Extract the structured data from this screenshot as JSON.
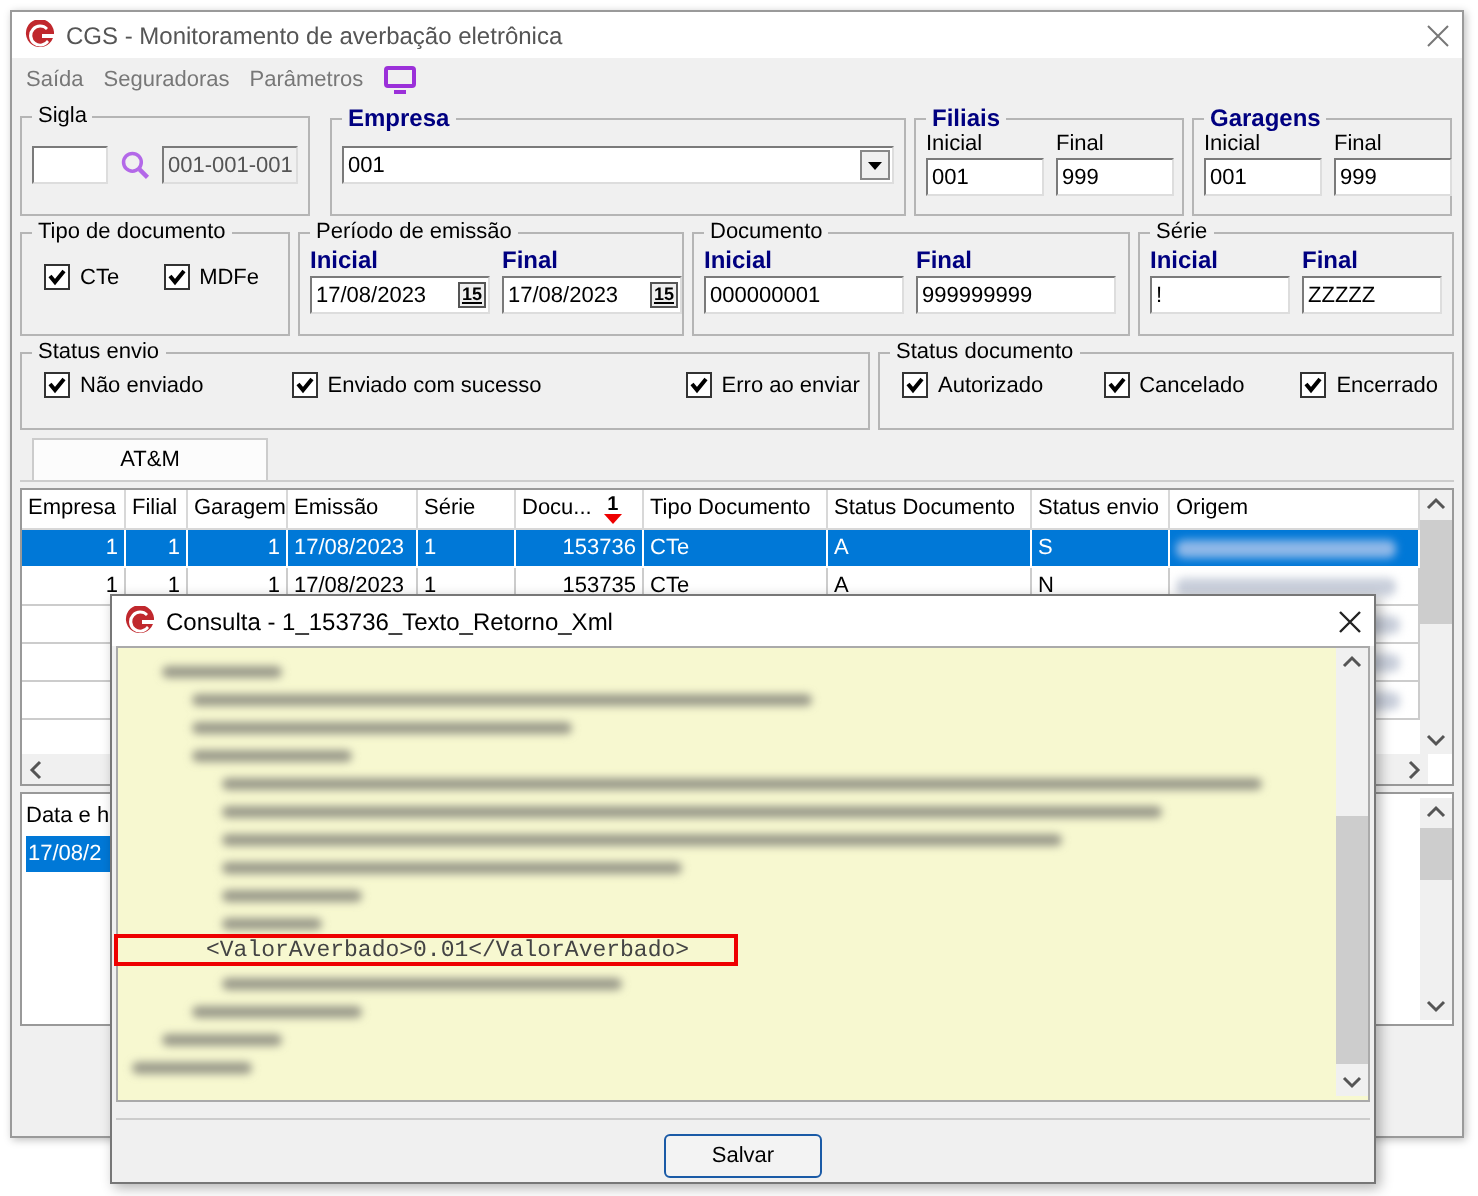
{
  "window": {
    "title": "CGS - Monitoramento de averbação eletrônica"
  },
  "menu": [
    {
      "label": "Saída"
    },
    {
      "label": "Seguradoras"
    },
    {
      "label": "Parâmetros"
    }
  ],
  "sigla": {
    "title": "Sigla",
    "code": "001-001-001"
  },
  "empresa": {
    "title": "Empresa",
    "value": "001"
  },
  "filiais": {
    "title": "Filiais",
    "inicial_label": "Inicial",
    "inicial": "001",
    "final_label": "Final",
    "final": "999"
  },
  "garagens": {
    "title": "Garagens",
    "inicial_label": "Inicial",
    "inicial": "001",
    "final_label": "Final",
    "final": "999"
  },
  "tipo_documento": {
    "title": "Tipo de documento",
    "options": [
      {
        "label": "CTe",
        "checked": true
      },
      {
        "label": "MDFe",
        "checked": true
      }
    ]
  },
  "periodo_emissao": {
    "title": "Período de emissão",
    "inicial_label": "Inicial",
    "inicial": "17/08/2023",
    "final_label": "Final",
    "final": "17/08/2023",
    "inicial_picker": "15",
    "final_picker": "15"
  },
  "documento": {
    "title": "Documento",
    "inicial_label": "Inicial",
    "inicial": "000000001",
    "final_label": "Final",
    "final": "999999999"
  },
  "serie": {
    "title": "Série",
    "inicial_label": "Inicial",
    "inicial": "!",
    "final_label": "Final",
    "final": "ZZZZZ"
  },
  "status_envio": {
    "title": "Status envio",
    "options": [
      {
        "label": "Não enviado",
        "checked": true
      },
      {
        "label": "Enviado com sucesso",
        "checked": true
      },
      {
        "label": "Erro ao enviar",
        "checked": true
      }
    ]
  },
  "status_documento": {
    "title": "Status documento",
    "options": [
      {
        "label": "Autorizado",
        "checked": true
      },
      {
        "label": "Cancelado",
        "checked": true
      },
      {
        "label": "Encerrado",
        "checked": true
      }
    ]
  },
  "tabs": [
    {
      "label": "AT&M",
      "selected": true
    }
  ],
  "table": {
    "columns": [
      {
        "label": "Empresa"
      },
      {
        "label": "Filial"
      },
      {
        "label": "Garagem"
      },
      {
        "label": "Emissão"
      },
      {
        "label": "Série"
      },
      {
        "label": "Docu...",
        "sort_rank": "1"
      },
      {
        "label": "Tipo Documento"
      },
      {
        "label": "Status Documento"
      },
      {
        "label": "Status envio"
      },
      {
        "label": "Origem"
      }
    ],
    "rows": [
      {
        "cells": [
          "1",
          "1",
          "1",
          "17/08/2023",
          "1",
          "153736",
          "CTe",
          "A",
          "S"
        ],
        "selected": true
      },
      {
        "cells": [
          "1",
          "1",
          "1",
          "17/08/2023",
          "1",
          "153735",
          "CTe",
          "A",
          "N"
        ],
        "selected": false
      }
    ]
  },
  "log": {
    "columns": [
      "Data e h"
    ],
    "rows": [
      {
        "cells": [
          "17/08/2"
        ],
        "selected": true
      }
    ]
  },
  "dialog": {
    "title": "Consulta - 1_153736_Texto_Retorno_Xml",
    "highlighted_line": "<ValorAverbado>0.01</ValorAverbado>",
    "button": "Salvar"
  }
}
